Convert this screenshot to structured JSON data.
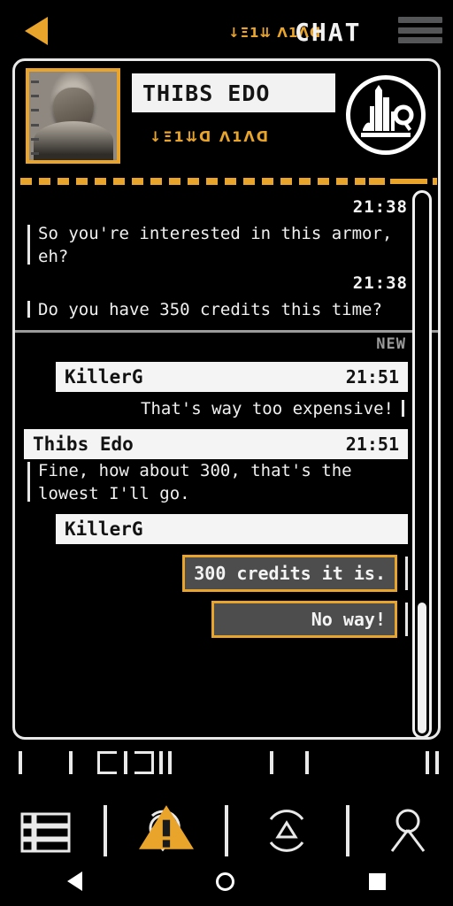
{
  "topbar": {
    "back_icon": "back-arrow-icon",
    "alien_glyphs": "↓Ξ1⇊ Λ1ᐱᗡ",
    "title": "CHAT",
    "menu_icon": "hamburger-menu-icon"
  },
  "contact": {
    "name": "THIBS EDO",
    "alien_subtitle": "↓Ξ1⇊ᗡ Λ1ᐱᗡ",
    "avatar_icon": "contact-portrait",
    "emblem_icon": "city-skyline-emblem"
  },
  "conversation": {
    "new_label": "NEW",
    "old_messages": [
      {
        "time": "21:38",
        "text": "So you're interested in this armor, eh?",
        "side": "left"
      },
      {
        "time": "21:38",
        "text": "Do you have 350 credits this time?",
        "side": "left"
      }
    ],
    "new_messages": [
      {
        "sender": "KillerG",
        "time": "21:51",
        "text": "That's way too expensive!",
        "side": "right"
      },
      {
        "sender": "Thibs Edo",
        "time": "21:51",
        "text": "Fine, how about 300, that's the lowest I'll go.",
        "side": "left"
      }
    ],
    "pending_sender": "KillerG",
    "reply_options": [
      {
        "label": "300 credits it is."
      },
      {
        "label": "No way!"
      }
    ]
  },
  "scrollbar": {
    "name": "message-scrollbar"
  },
  "bottom_nav": {
    "items": [
      {
        "icon": "list-menu-icon",
        "badge": null
      },
      {
        "icon": "location-pin-icon",
        "badge": "alert-warning-badge"
      },
      {
        "icon": "radar-scanner-icon",
        "badge": null
      },
      {
        "icon": "person-profile-icon",
        "badge": null
      }
    ]
  },
  "android_nav": {
    "back": "android-back-icon",
    "home": "android-home-icon",
    "recents": "android-recents-icon"
  },
  "colors": {
    "accent_amber": "#E8A42B",
    "panel_border": "#E8E8E8",
    "text_light": "#F0F0F0",
    "button_fill": "#4D4D4D",
    "divider_gray": "#9B9B9B",
    "background": "#000000"
  }
}
